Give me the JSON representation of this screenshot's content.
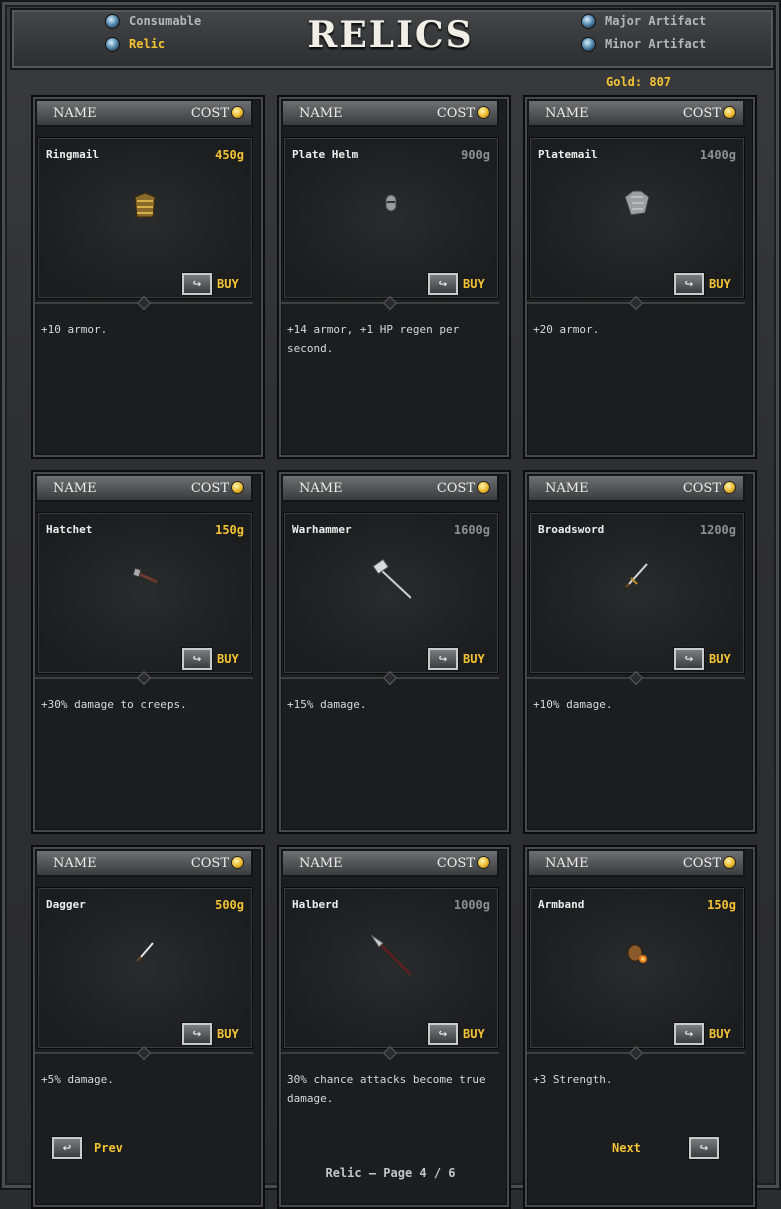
{
  "title": "RELICS",
  "tabs": [
    {
      "label": "Consumable",
      "active": false
    },
    {
      "label": "Relic",
      "active": true
    },
    {
      "label": "Major Artifact",
      "active": false
    },
    {
      "label": "Minor Artifact",
      "active": false
    }
  ],
  "gold": "Gold: 807",
  "column_headers": {
    "name": "NAME",
    "cost": "COST"
  },
  "buy_label": "BUY",
  "items": [
    {
      "name": "Ringmail",
      "cost": "450g",
      "affordable": true,
      "icon": "ringmail-icon",
      "description": "+10 armor."
    },
    {
      "name": "Plate Helm",
      "cost": "900g",
      "affordable": false,
      "icon": "plate-helm-icon",
      "description": "+14 armor, +1 HP regen per second."
    },
    {
      "name": "Platemail",
      "cost": "1400g",
      "affordable": false,
      "icon": "platemail-icon",
      "description": "+20 armor."
    },
    {
      "name": "Hatchet",
      "cost": "150g",
      "affordable": true,
      "icon": "hatchet-icon",
      "description": "+30% damage to creeps."
    },
    {
      "name": "Warhammer",
      "cost": "1600g",
      "affordable": false,
      "icon": "warhammer-icon",
      "description": "+15% damage."
    },
    {
      "name": "Broadsword",
      "cost": "1200g",
      "affordable": false,
      "icon": "broadsword-icon",
      "description": "+10% damage."
    },
    {
      "name": "Dagger",
      "cost": "500g",
      "affordable": true,
      "icon": "dagger-icon",
      "description": "+5% damage."
    },
    {
      "name": "Halberd",
      "cost": "1000g",
      "affordable": false,
      "icon": "halberd-icon",
      "description": "30% chance attacks become true damage."
    },
    {
      "name": "Armband",
      "cost": "150g",
      "affordable": true,
      "icon": "armband-icon",
      "description": "+3 Strength."
    }
  ],
  "nav": {
    "prev": "Prev",
    "next": "Next"
  },
  "footer": "Relic — Page 4 / 6",
  "colors": {
    "gold": "#f3c335",
    "unaffordable": "#8d8e90"
  }
}
